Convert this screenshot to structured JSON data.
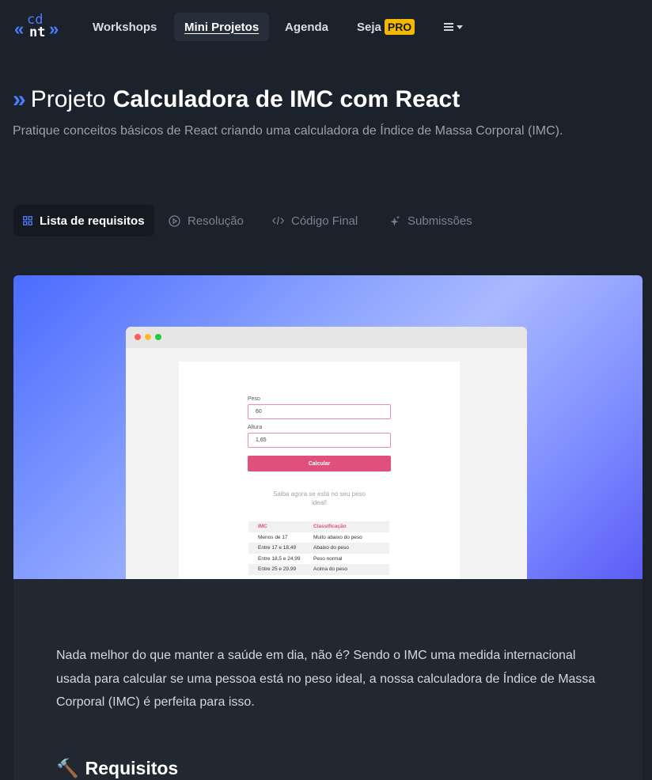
{
  "header": {
    "logo": {
      "top": "cd",
      "bottom": "nt",
      "left_mark": "«",
      "right_mark": "»"
    },
    "nav": [
      {
        "label": "Workshops",
        "active": false
      },
      {
        "label": "Mini Projetos",
        "active": true
      },
      {
        "label": "Agenda",
        "active": false
      },
      {
        "label": "Seja",
        "badge": "PRO",
        "active": false
      }
    ],
    "menu_icon": "hamburger-caret-icon"
  },
  "page": {
    "title_prefix_icon": "double-chevron-icon",
    "title_prefix": "Projeto",
    "title": "Calculadora de IMC com React",
    "subtitle": "Pratique conceitos básicos de React criando uma calculadora de Índice de Massa Corporal (IMC)."
  },
  "tabs": [
    {
      "label": "Lista de requisitos",
      "icon": "grid-icon",
      "active": true
    },
    {
      "label": "Resolução",
      "icon": "play-circle-icon",
      "active": false
    },
    {
      "label": "Código Final",
      "icon": "code-icon",
      "active": false
    },
    {
      "label": "Submissões",
      "icon": "sparkle-icon",
      "active": false
    }
  ],
  "preview": {
    "peso_label": "Peso",
    "peso_value": "60",
    "altura_label": "Altura",
    "altura_value": "1,65",
    "button": "Calcular",
    "hint": "Saiba agora se está no seu peso ideal!",
    "table_headers": [
      "IMC",
      "Classificação"
    ],
    "table_rows": [
      [
        "Menos de 17",
        "Muito abaixo do peso"
      ],
      [
        "Entre 17 e 18,49",
        "Abaixo do peso"
      ],
      [
        "Entre 18,5 e 24,99",
        "Peso normal"
      ],
      [
        "Entre 25 e 29,99",
        "Acima do peso"
      ]
    ]
  },
  "content": {
    "intro": "Nada melhor do que manter a saúde em dia, não é? Sendo o IMC uma medida internacional usada para calcular se uma pessoa está no peso ideal, a nossa calculadora de Índice de Massa Corporal (IMC) é perfeita para isso.",
    "requirements_icon": "🔨",
    "requirements_heading": "Requisitos"
  },
  "colors": {
    "background": "#1c222b",
    "accent": "#4d7dff",
    "pro_badge": "#f5b800",
    "mock_accent": "#e0507c"
  }
}
